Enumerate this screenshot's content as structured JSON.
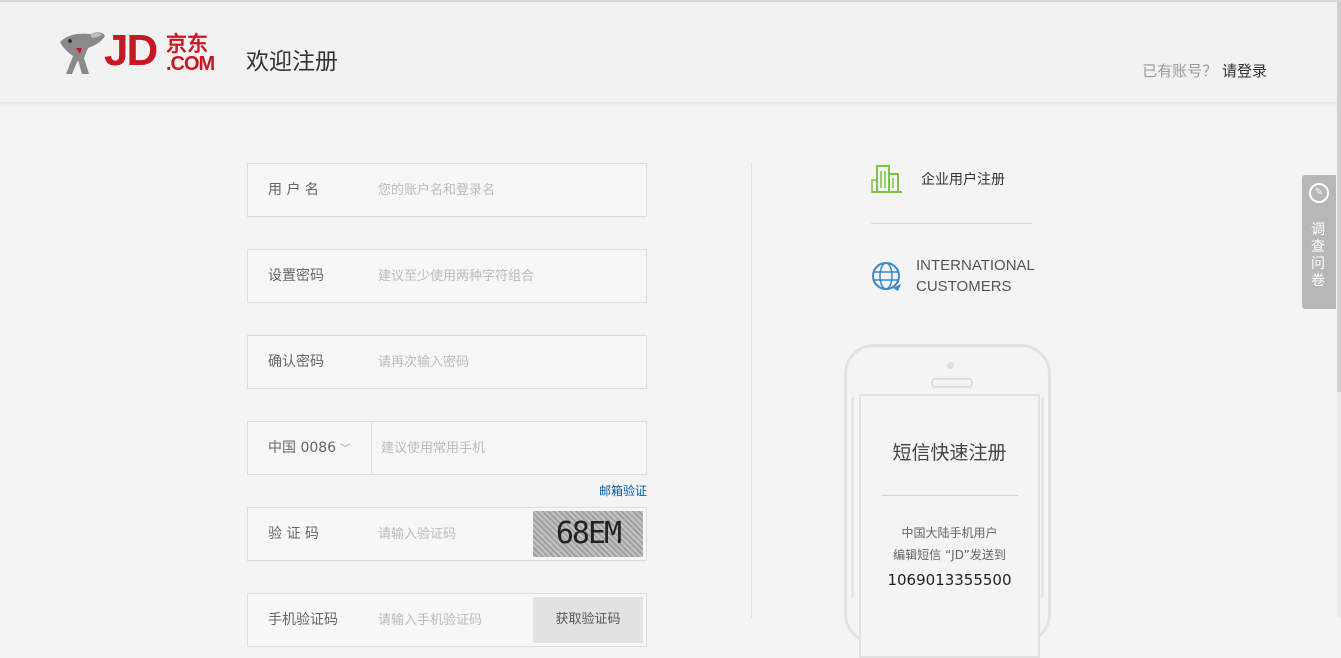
{
  "header": {
    "logo": {
      "main": "JD",
      "chinese": "京东",
      "domain": ".COM"
    },
    "title": "欢迎注册",
    "login_prompt": "已有账号？",
    "login_link": "请登录"
  },
  "form": {
    "username": {
      "label": "用 户 名",
      "placeholder": "您的账户名和登录名"
    },
    "password": {
      "label": "设置密码",
      "placeholder": "建议至少使用两种字符组合"
    },
    "confirm_password": {
      "label": "确认密码",
      "placeholder": "请再次输入密码"
    },
    "phone": {
      "country_code": "中国 0086",
      "placeholder": "建议使用常用手机"
    },
    "email_verify_link": "邮箱验证",
    "captcha": {
      "label": "验 证 码",
      "placeholder": "请输入验证码",
      "image_text": "68EM"
    },
    "sms_code": {
      "label": "手机验证码",
      "placeholder": "请输入手机验证码",
      "button": "获取验证码"
    }
  },
  "side": {
    "enterprise_register": "企业用户注册",
    "international_line1": "INTERNATIONAL",
    "international_line2": "CUSTOMERS",
    "sms_register": {
      "title": "短信快速注册",
      "line1": "中国大陆手机用户",
      "line2": "编辑短信 “JD”发送到",
      "number": "1069013355500"
    }
  },
  "survey_tab": {
    "label": "调查问卷"
  },
  "colors": {
    "brand": "#c81623",
    "link": "#005ea7",
    "icon_green": "#7cc243",
    "icon_blue": "#3a88c8"
  },
  "icons": [
    "jd-dog-logo-icon",
    "building-icon",
    "globe-icon",
    "survey-icon",
    "chevron-down-icon"
  ]
}
